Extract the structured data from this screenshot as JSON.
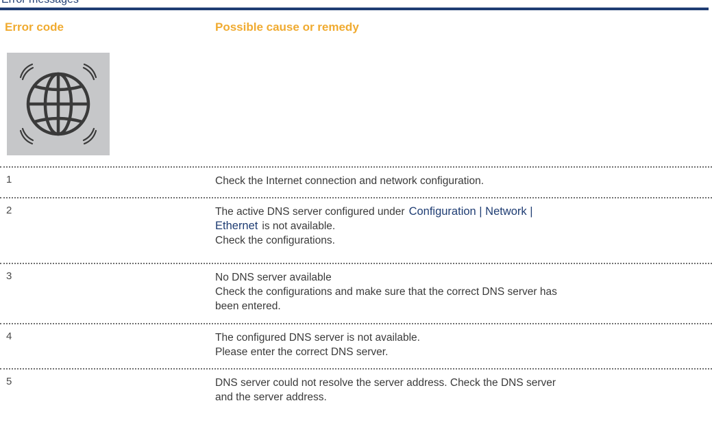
{
  "section_heading": "Error messages",
  "table": {
    "headers": [
      "Error code",
      "Possible cause or remedy"
    ],
    "icon": "globe-icon",
    "rows": [
      {
        "code": "1",
        "lines": [
          "Check the Internet connection and network configuration."
        ]
      },
      {
        "code": "2",
        "line1_prefix": "The active DNS server configured under",
        "link_part1": "Configuration | Network |",
        "link_part2": "Ethernet",
        "line2_suffix": "is not available.",
        "line3": "Check the configurations."
      },
      {
        "code": "3",
        "lines": [
          "No DNS server available",
          "Check the configurations and make sure that the correct DNS server has",
          "been entered."
        ]
      },
      {
        "code": "4",
        "lines": [
          "The configured DNS server is not available.",
          "Please enter the correct DNS server."
        ]
      },
      {
        "code": "5",
        "lines": [
          "DNS server could not resolve the server address. Check the DNS server",
          "and the server address."
        ]
      }
    ]
  },
  "colors": {
    "rule": "#1f3d73",
    "header_text": "#f0ab31",
    "link": "#1f3d73",
    "icon_tile": "#c6c7c9"
  }
}
